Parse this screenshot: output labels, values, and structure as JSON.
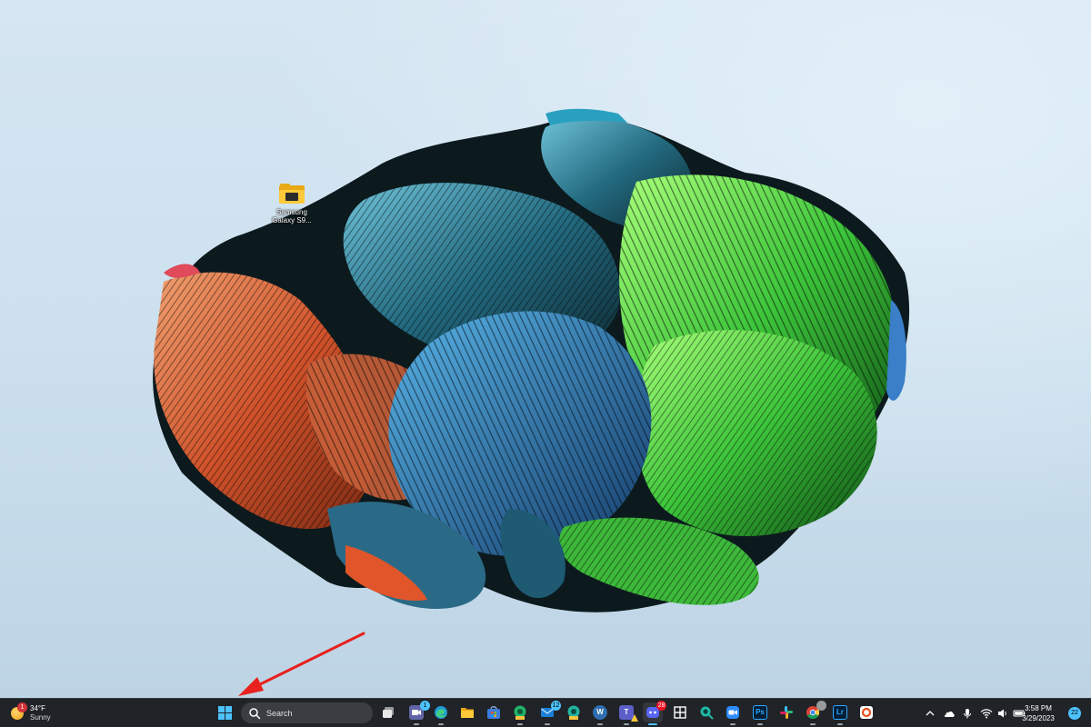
{
  "desktop": {
    "icons": [
      {
        "label": "Samsung Galaxy S9...",
        "icon": "folder-icon"
      }
    ]
  },
  "taskbar": {
    "weather": {
      "badge": "1",
      "temperature": "34°F",
      "condition": "Sunny",
      "icon": "sun-icon"
    },
    "start": {
      "icon": "windows-start-icon"
    },
    "search": {
      "placeholder": "Search",
      "icon": "search-icon"
    },
    "apps": [
      {
        "name": "task-view",
        "icon": "task-view-icon",
        "color": "#dddddd"
      },
      {
        "name": "teams-chat",
        "icon": "teams-chat-icon",
        "color": "#6264a7",
        "badge": "1"
      },
      {
        "name": "edge",
        "icon": "edge-icon",
        "color": "#1f9bd7"
      },
      {
        "name": "file-explorer",
        "icon": "folder-icon",
        "color": "#f5c342"
      },
      {
        "name": "microsoft-store",
        "icon": "store-icon",
        "color": "#3d7be0"
      },
      {
        "name": "edge-dev",
        "icon": "edge-dev-icon",
        "color": "#21b36a",
        "tag": "DEV"
      },
      {
        "name": "mail",
        "icon": "mail-icon",
        "color": "#1a7fd6",
        "badge": "12"
      },
      {
        "name": "edge-canary",
        "icon": "edge-canary-icon",
        "color": "#22b5a0",
        "tag": "CAN"
      },
      {
        "name": "wordpress",
        "icon": "wordpress-icon",
        "color": "#2f6fb0",
        "text": "W"
      },
      {
        "name": "teams",
        "icon": "teams-icon",
        "color": "#5b5fc7",
        "text": "T"
      },
      {
        "name": "discord",
        "icon": "discord-icon",
        "color": "#5865f2",
        "badge": "28"
      },
      {
        "name": "pane-app",
        "icon": "grid-app-icon",
        "color": "#ffffff"
      },
      {
        "name": "search-app",
        "icon": "magnifier-app-icon",
        "color": "#1fb8a8"
      },
      {
        "name": "zoom",
        "icon": "zoom-icon",
        "color": "#2d8cff"
      },
      {
        "name": "photoshop",
        "icon": "photoshop-icon",
        "color": "#001e36",
        "text": "Ps"
      },
      {
        "name": "slack",
        "icon": "slack-icon",
        "color": "#e01e5a"
      },
      {
        "name": "chrome",
        "icon": "chrome-icon",
        "color": "#4285f4"
      },
      {
        "name": "lightroom",
        "icon": "lightroom-icon",
        "color": "#001e36",
        "text": "Lr"
      },
      {
        "name": "opera-app",
        "icon": "ring-app-icon",
        "color": "#ffffff"
      }
    ],
    "tray": {
      "icons": [
        "chevron-up-icon",
        "onedrive-icon",
        "microphone-icon",
        "wifi-icon",
        "speaker-icon",
        "battery-icon"
      ],
      "time": "3:58 PM",
      "date": "3/29/2023",
      "notifications": "22"
    }
  },
  "colors": {
    "accent": "#4cc2ff",
    "taskbar": "#202327",
    "arrow": "#e8201e"
  }
}
